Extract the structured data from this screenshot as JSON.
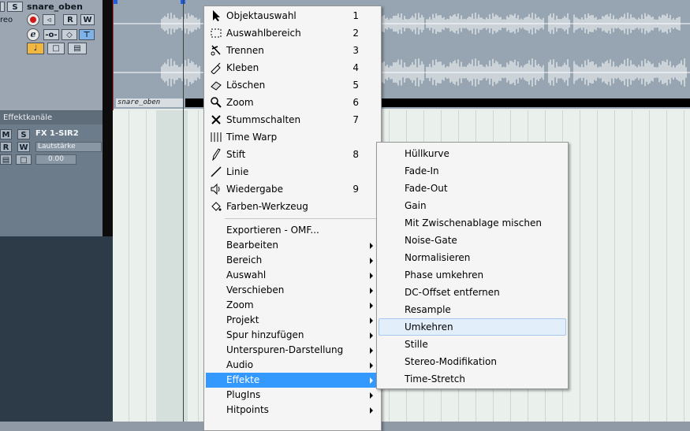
{
  "track": {
    "name": "snare_oben",
    "channel_partial": "reo",
    "buttons": {
      "mute": "M",
      "solo": "S",
      "read": "R",
      "write": "W"
    }
  },
  "fx_section": {
    "header": "Effektkanäle",
    "track_name": "FX 1-SIR2",
    "param_label": "Lautstärke",
    "param_value": "0.00",
    "buttons": {
      "mute": "M",
      "solo": "S",
      "read": "R",
      "write": "W"
    }
  },
  "event": {
    "name": "snare_oben"
  },
  "context_menu": {
    "tools": [
      {
        "label": "Objektauswahl",
        "key": "1",
        "icon": "arrow-pointer-icon"
      },
      {
        "label": "Auswahlbereich",
        "key": "2",
        "icon": "range-selection-icon"
      },
      {
        "label": "Trennen",
        "key": "3",
        "icon": "scissors-icon"
      },
      {
        "label": "Kleben",
        "key": "4",
        "icon": "glue-tube-icon"
      },
      {
        "label": "Löschen",
        "key": "5",
        "icon": "eraser-icon"
      },
      {
        "label": "Zoom",
        "key": "6",
        "icon": "magnifier-icon"
      },
      {
        "label": "Stummschalten",
        "key": "7",
        "icon": "mute-x-icon"
      },
      {
        "label": "Time Warp",
        "key": "",
        "icon": "time-warp-icon"
      },
      {
        "label": "Stift",
        "key": "8",
        "icon": "pencil-icon"
      },
      {
        "label": "Linie",
        "key": "",
        "icon": "line-icon"
      },
      {
        "label": "Wiedergabe",
        "key": "9",
        "icon": "speaker-icon"
      },
      {
        "label": "Farben-Werkzeug",
        "key": "",
        "icon": "paint-bucket-icon"
      }
    ],
    "export_label": "Exportieren - OMF...",
    "submenus": [
      {
        "label": "Bearbeiten"
      },
      {
        "label": "Bereich"
      },
      {
        "label": "Auswahl"
      },
      {
        "label": "Verschieben"
      },
      {
        "label": "Zoom"
      },
      {
        "label": "Projekt"
      },
      {
        "label": "Spur hinzufügen"
      },
      {
        "label": "Unterspuren-Darstellung"
      },
      {
        "label": "Audio"
      },
      {
        "label": "Effekte"
      },
      {
        "label": "PlugIns"
      },
      {
        "label": "Hitpoints"
      }
    ],
    "highlighted": "Effekte"
  },
  "effects_submenu": {
    "items": [
      "Hüllkurve",
      "Fade-In",
      "Fade-Out",
      "Gain",
      "Mit Zwischenablage mischen",
      "Noise-Gate",
      "Normalisieren",
      "Phase umkehren",
      "DC-Offset entfernen",
      "Resample",
      "Umkehren",
      "Stille",
      "Stereo-Modifikation",
      "Time-Stretch"
    ],
    "hovered": "Umkehren"
  },
  "colors": {
    "highlight": "#3399ff",
    "hover": "#e3eefb",
    "event_bg": "#97a4b1",
    "waveform": "#ffffff"
  }
}
